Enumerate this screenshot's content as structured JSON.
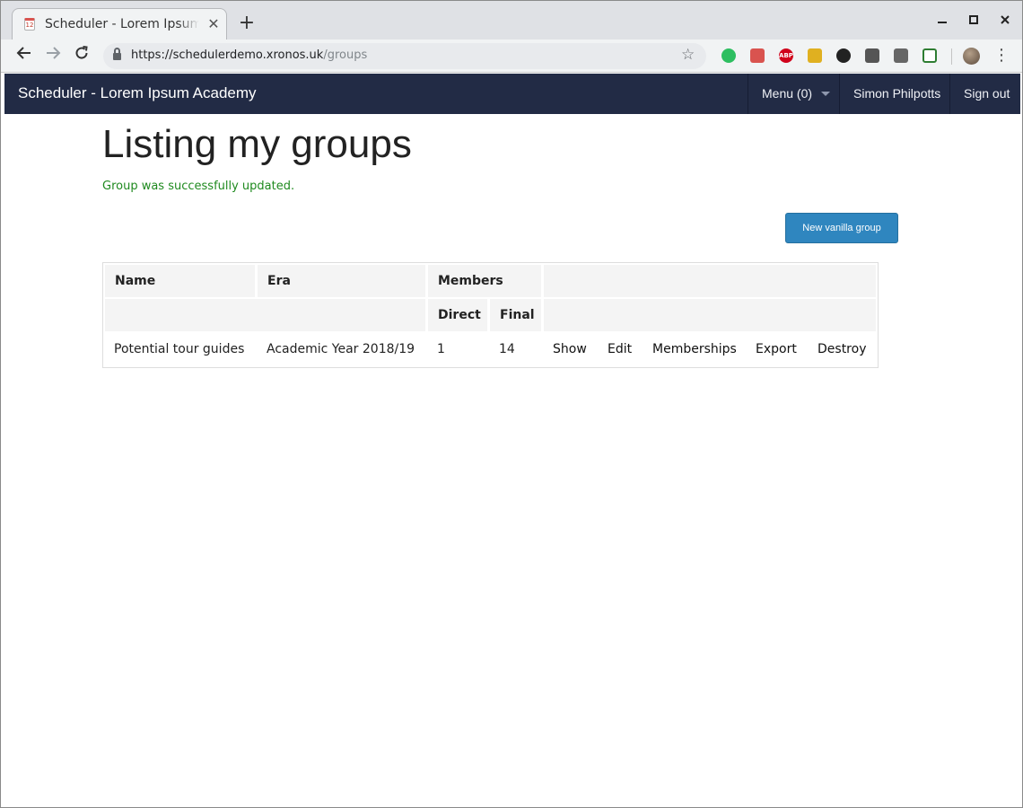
{
  "browser": {
    "tab_title": "Scheduler - Lorem Ipsum Academy",
    "tab_favicon_text": "12",
    "new_tab_symbol": "+",
    "url_host": "https://schedulerdemo.xronos.uk",
    "url_path": "/groups",
    "extensions": [
      {
        "name": "evernote-extension-icon",
        "color": "#2dbe60"
      },
      {
        "name": "tampermonkey-extension-icon",
        "color": "#d9534f"
      },
      {
        "name": "adblock-plus-icon",
        "color": "#d0021b",
        "label": "ABP"
      },
      {
        "name": "house-extension-icon",
        "color": "#e0b020"
      },
      {
        "name": "gnome-extension-icon",
        "color": "#222222"
      },
      {
        "name": "privacy-extension-icon",
        "color": "#555555"
      },
      {
        "name": "mail-extension-icon",
        "color": "#555555"
      },
      {
        "name": "screenshot-extension-icon",
        "color": "#2e7d32"
      }
    ]
  },
  "navbar": {
    "brand": "Scheduler - Lorem Ipsum Academy",
    "menu_label": "Menu (0)",
    "user_name": "Simon Philpotts",
    "sign_out": "Sign out"
  },
  "page": {
    "title": "Listing my groups",
    "notice": "Group was successfully updated.",
    "new_group_button": "New vanilla group"
  },
  "table": {
    "headers": {
      "name": "Name",
      "era": "Era",
      "members": "Members",
      "direct": "Direct",
      "final": "Final"
    },
    "rows": [
      {
        "name": "Potential tour guides",
        "era": "Academic Year 2018/19",
        "direct": "1",
        "final": "14",
        "actions": [
          "Show",
          "Edit",
          "Memberships",
          "Export",
          "Destroy"
        ]
      }
    ]
  }
}
